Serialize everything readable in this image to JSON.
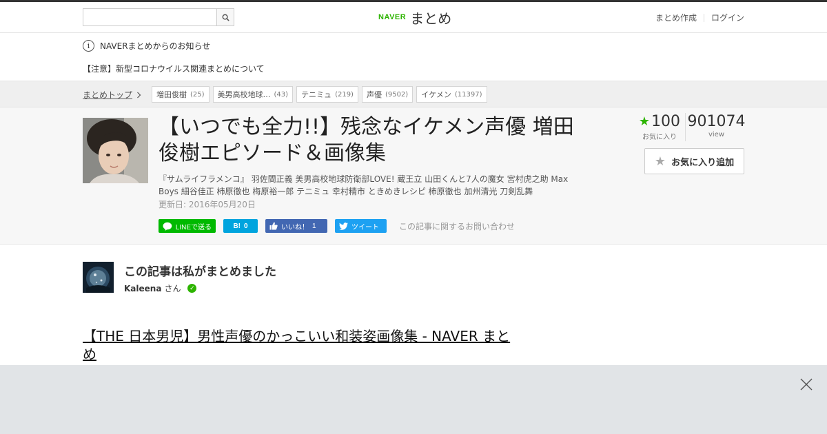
{
  "header": {
    "search": {
      "value": "",
      "placeholder": ""
    },
    "logo": {
      "brand": "NAVER",
      "service": "まとめ"
    },
    "links": [
      {
        "label": "まとめ作成"
      },
      {
        "label": "ログイン"
      }
    ]
  },
  "notice": {
    "heading": "NAVERまとめからのお知らせ",
    "item": "【注意】新型コロナウイルス関連まとめについて"
  },
  "breadcrumb": {
    "top_label": "まとめトップ",
    "tags": [
      {
        "label": "増田俊樹",
        "count": "(25)"
      },
      {
        "label": "美男高校地球…",
        "count": "(43)"
      },
      {
        "label": "テニミュ",
        "count": "(219)"
      },
      {
        "label": "声優",
        "count": "(9502)"
      },
      {
        "label": "イケメン",
        "count": "(11397)"
      }
    ]
  },
  "article": {
    "title": "【いつでも全力!!】残念なイケメン声優 増田俊樹エピソード＆画像集",
    "tags_text": "『サムライフラメンコ』 羽佐間正義 美男高校地球防衛部LOVE! 蔵王立 山田くんと7人の魔女 宮村虎之助 Max Boys 細谷佳正 柿原徹也 梅原裕一郎 テニミュ 幸村精市 ときめきレシピ 柿原徹也 加州清光 刀剣乱舞",
    "updated": "更新日: 2016年05月20日",
    "share": {
      "line": "LINEで送る",
      "hatena_mark": "B!",
      "hatena_count": "0",
      "fb": "いいね！",
      "fb_count": "1",
      "tweet": "ツイート",
      "inquiry": "この記事に関するお問い合わせ"
    },
    "stats": {
      "favorites": "100",
      "favorites_label": "お気に入り",
      "views": "901074",
      "views_label": "view"
    },
    "fav_button": "お気に入り追加"
  },
  "curator": {
    "heading": "この記事は私がまとめました",
    "name": "Kaleena",
    "suffix": "さん"
  },
  "link": {
    "text": "【THE 日本男児】男性声優のかっこいい和装姿画像集 - NAVER まとめ"
  },
  "colors": {
    "naver_green": "#2db400",
    "line": "#00b900",
    "hatena": "#00a4de",
    "facebook": "#4267b2",
    "twitter": "#1da1f2",
    "ad_background": "#e1e4e7"
  },
  "icons": [
    "search-icon",
    "info-icon",
    "chevron-right-icon",
    "star-icon",
    "line-icon",
    "facebook-thumb-icon",
    "twitter-bird-icon",
    "verified-check-icon",
    "close-icon"
  ]
}
